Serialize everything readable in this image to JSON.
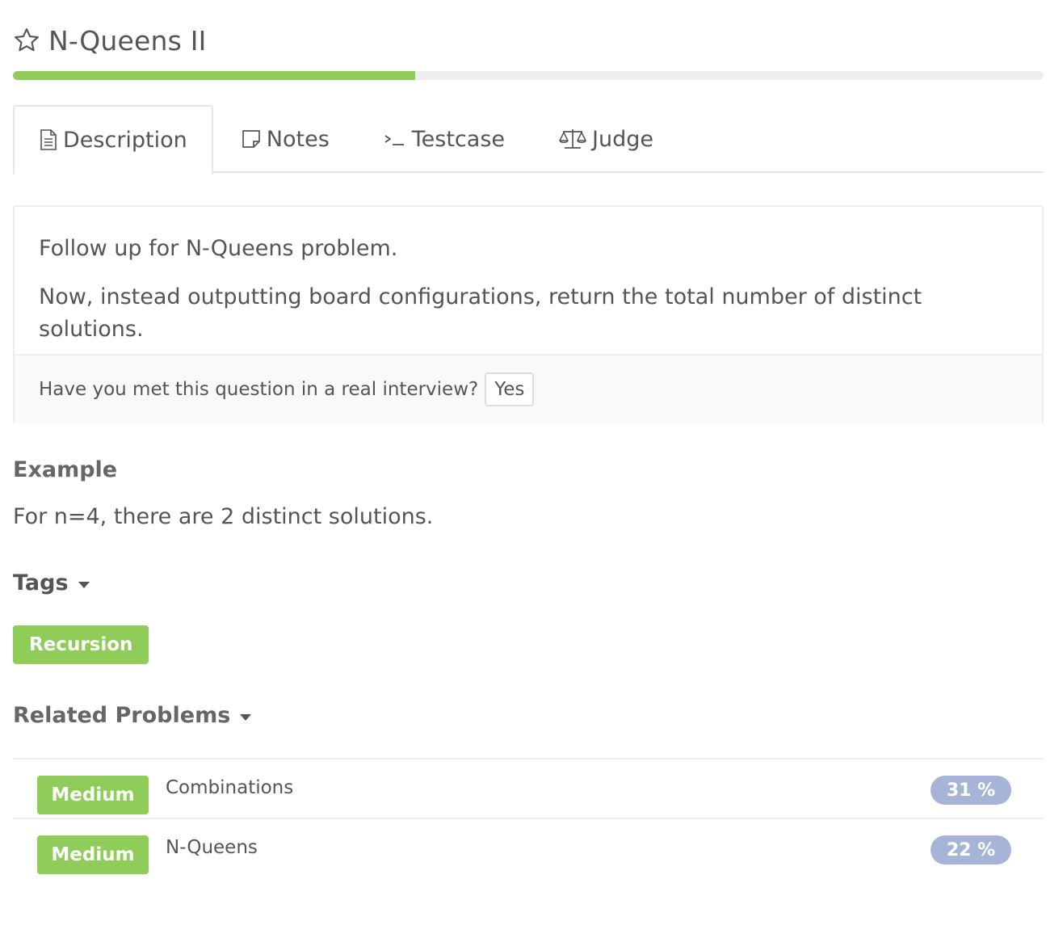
{
  "header": {
    "title": "N-Queens II",
    "star_icon": "star-outline-icon",
    "progress_fraction": 0.39,
    "progress_color": "#8fcc5a"
  },
  "tabs": [
    {
      "label": "Description",
      "icon": "document-icon",
      "active": true
    },
    {
      "label": "Notes",
      "icon": "note-icon",
      "active": false
    },
    {
      "label": "Testcase",
      "icon": "terminal-icon",
      "active": false
    },
    {
      "label": "Judge",
      "icon": "scale-icon",
      "active": false
    }
  ],
  "description": {
    "paragraphs": [
      "Follow up for N-Queens problem.",
      "Now, instead outputting board configurations, return the total number of distinct solutions."
    ],
    "interview_question": "Have you met this question in a real interview?",
    "yes_label": "Yes"
  },
  "example": {
    "heading": "Example",
    "text": "For n=4, there are 2 distinct solutions."
  },
  "tags": {
    "heading": "Tags",
    "items": [
      "Recursion"
    ]
  },
  "related": {
    "heading": "Related Problems",
    "items": [
      {
        "difficulty": "Medium",
        "name": "Combinations",
        "percent": "31 %"
      },
      {
        "difficulty": "Medium",
        "name": "N-Queens",
        "percent": "22 %"
      }
    ]
  },
  "colors": {
    "accent_green": "#8fcc5a",
    "percent_badge": "#a6b4d8"
  }
}
